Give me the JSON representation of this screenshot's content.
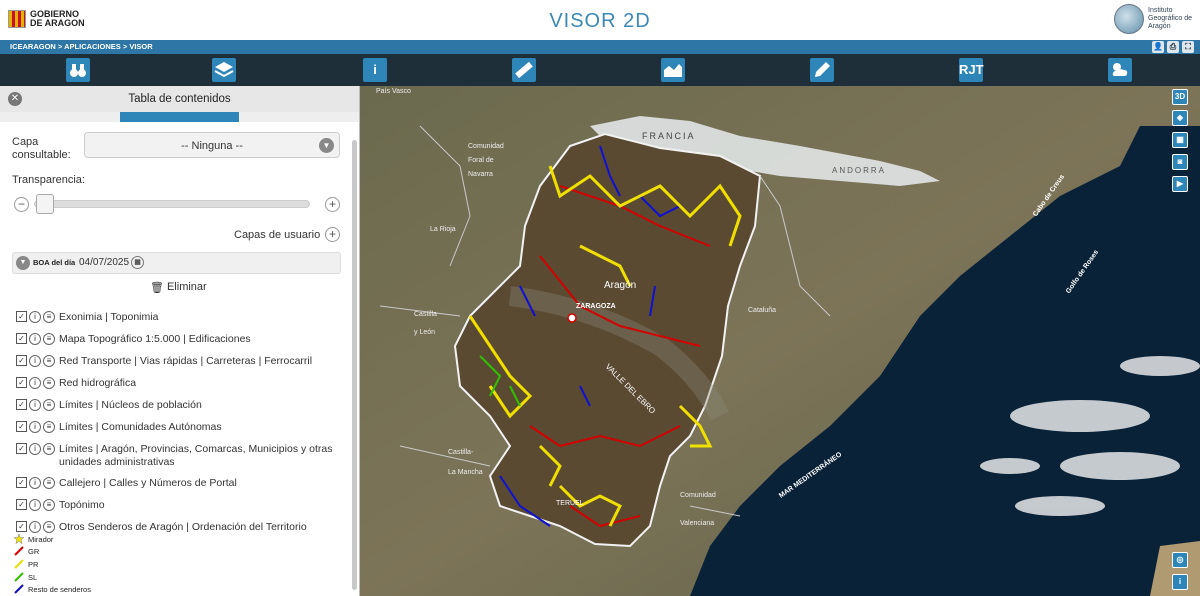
{
  "header": {
    "gov_logo_line1": "GOBIERNO",
    "gov_logo_line2": "DE ARAGON",
    "title": "VISOR 2D",
    "iga_line1": "Instituto",
    "iga_line2": "Geográfico de",
    "iga_line3": "Aragón"
  },
  "breadcrumb": "ICEARAGON  >  APLICACIONES  >  VISOR",
  "toolbar": {
    "info_label": "i",
    "rjt_label": "RJT"
  },
  "panel": {
    "title": "Tabla de contenidos",
    "capa_label": "Capa consultable:",
    "capa_value": "-- Ninguna --",
    "transparencia_label": "Transparencia:",
    "capas_usuario_label": "Capas de usuario",
    "boa_label": "BOA del día",
    "boa_date": "04/07/2025",
    "eliminar_label": "Eliminar",
    "layers": [
      "Exonimia | Toponimia",
      "Mapa Topográfico 1:5.000 | Edificaciones",
      "Red Transporte | Vias rápidas | Carreteras | Ferrocarril",
      "Red hidrográfica",
      "Límites | Núcleos de población",
      "Límites | Comunidades Autónomas",
      "Límites | Aragón, Provincias, Comarcas, Municipios y otras unidades administrativas",
      "Callejero | Calles y Números de Portal",
      "Topónimo",
      "Otros Senderos de Aragón | Ordenación del Territorio"
    ],
    "legend": [
      {
        "label": "Mirador",
        "color": "#f2e500"
      },
      {
        "label": "GR",
        "color": "#e00000"
      },
      {
        "label": "PR",
        "color": "#e8e000"
      },
      {
        "label": "SL",
        "color": "#30c000"
      },
      {
        "label": "Resto de senderos",
        "color": "#1010c0"
      }
    ]
  },
  "map": {
    "labels": {
      "pais_vasco": "País Vasco",
      "comunidad_navarra_1": "Comunidad",
      "comunidad_navarra_2": "Foral de",
      "comunidad_navarra_3": "Navarra",
      "francia": "FRANCIA",
      "andorra": "ANDORRA",
      "la_rioja": "La Rioja",
      "aragon": "Aragón",
      "zaragoza": "ZARAGOZA",
      "cataluna": "Cataluña",
      "castilla_leon_1": "Castilla",
      "castilla_leon_2": "y León",
      "castilla_mancha_1": "Castilla-",
      "castilla_mancha_2": "La Mancha",
      "comunidad_valenciana_1": "Comunidad",
      "comunidad_valenciana_2": "Valenciana",
      "valle_ebro": "VALLE DEL EBRO",
      "mar_mediterraneo": "MAR MEDITERRÁNEO",
      "cabo_creus": "Cabo de Creus",
      "golfo_roses": "Golfo de Roses",
      "teruel": "TERUEL"
    },
    "tools": {
      "three_d": "3D",
      "info": "i"
    }
  }
}
